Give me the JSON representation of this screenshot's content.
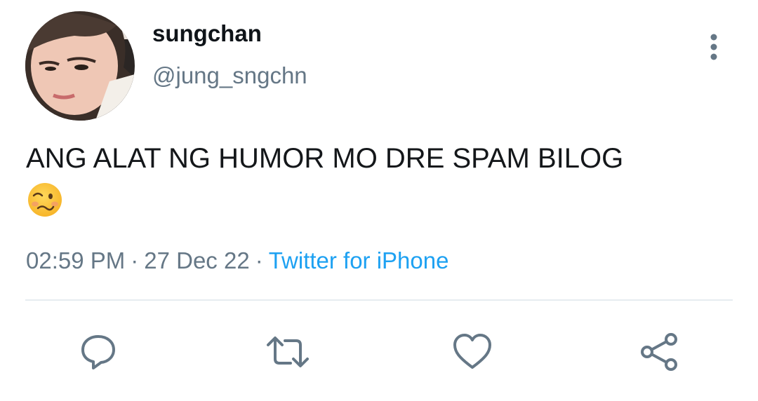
{
  "tweet": {
    "author": {
      "display_name": "sungchan",
      "handle": "@jung_sngchn",
      "avatar_icon": "profile-photo"
    },
    "text": "ANG ALAT NG HUMOR MO DRE SPAM BILOG",
    "emoji": "woozy-face",
    "meta": {
      "time": "02:59 PM",
      "separator": "·",
      "date": "27 Dec 22",
      "source": "Twitter for iPhone"
    }
  },
  "actions": [
    {
      "name": "reply",
      "icon": "comment-icon"
    },
    {
      "name": "retweet",
      "icon": "retweet-icon"
    },
    {
      "name": "like",
      "icon": "heart-icon"
    },
    {
      "name": "share",
      "icon": "share-icon"
    }
  ],
  "colors": {
    "text": "#14171a",
    "secondary": "#657786",
    "link": "#1da1f2",
    "icon": "#657786",
    "divider": "#e6ecf0"
  }
}
